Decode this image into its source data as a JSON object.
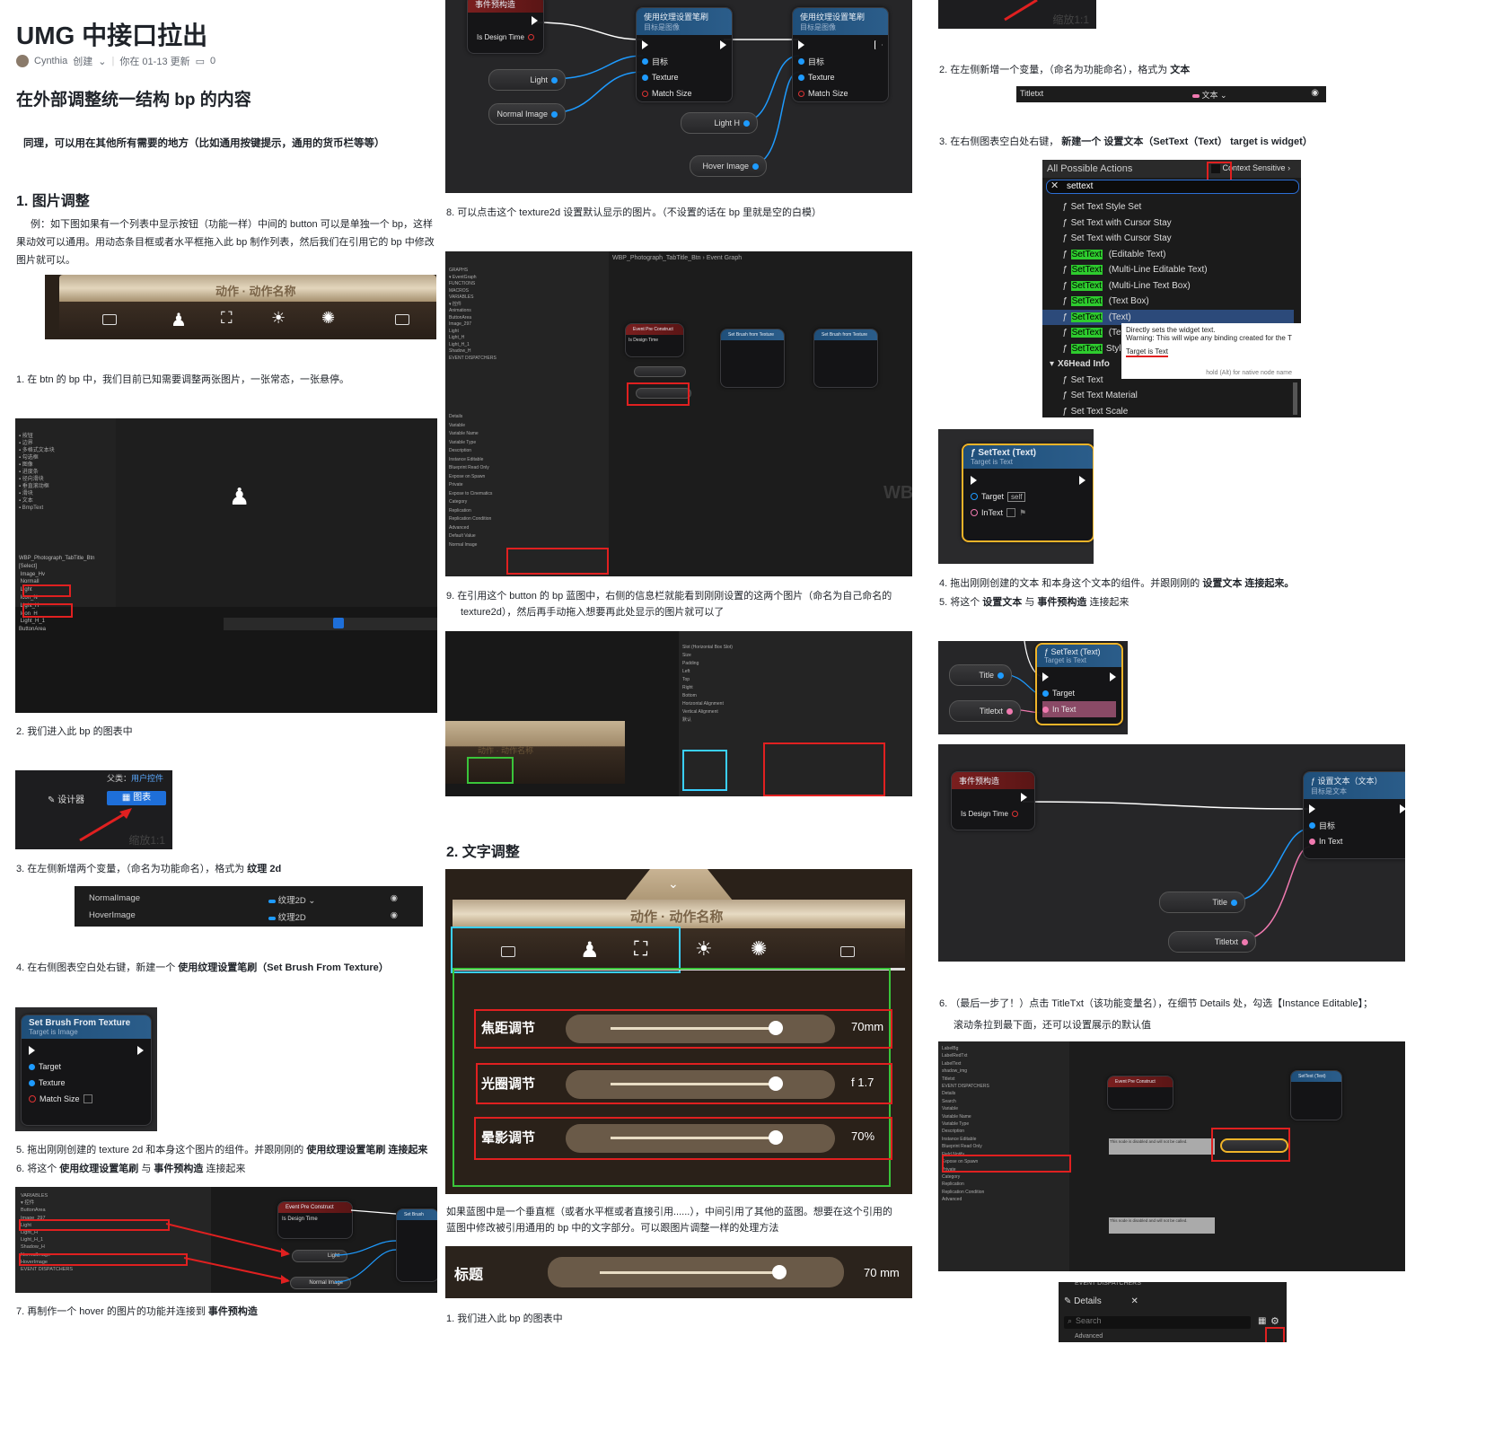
{
  "article": {
    "title": "UMG 中接口拉出",
    "author": "Cynthia",
    "author_action": "创建",
    "updated": "你在 01-13 更新",
    "comment_count": "0",
    "subtitle": "在外部调整统一结构 bp 的内容",
    "intro": "同理，可以用在其他所有需要的地方（比如通用按键提示，通用的货币栏等等）"
  },
  "section1": {
    "heading": "1.  图片调整",
    "para_line1": "例：如下图如果有一个列表中显示按钮（功能一样）中间的 button 可以是单独一个 bp，这样",
    "para_line2": "果动效可以通用。用动态条目框或者水平框拖入此 bp 制作列表，然后我们在引用它的 bp 中修改",
    "para_line3": "图片就可以。",
    "step1": "1.  在 btn 的 bp 中，我们目前已知需要调整两张图片，一张常态，一张悬停。",
    "step2": "2.  我们进入此 bp 的图表中",
    "step3_prefix": "3.  在左侧新增两个变量，（命名为功能命名），格式为",
    "step3_bold": "纹理 2d",
    "step4_prefix": "4.  在右侧图表空白处右键，新建一个",
    "step4_bold": "使用纹理设置笔刷（Set Brush From Texture）",
    "step5_prefix": "5.  拖出刚刚创建的 texture 2d 和本身这个图片的组件。并跟刚刚的",
    "step5_bold": "使用纹理设置笔刷 连接起来",
    "step6_prefix": "6.  将这个",
    "step6_bold1": "使用纹理设置笔刷",
    "step6_mid": "与",
    "step6_bold2": "事件预构造",
    "step6_suffix": "连接起来",
    "step7_prefix": "7.  再制作一个 hover 的图片的功能并连接到",
    "step7_bold": "事件预构造",
    "step8": "8.  可以点击这个 texture2d 设置默认显示的图片。（不设置的话在 bp 里就是空的白模）",
    "step9_line1": "9.  在引用这个 button 的 bp 蓝图中，右侧的信息栏就能看到刚刚设置的这两个图片（命名为自己命名的",
    "step9_line2": "texture2d），然后再手动拖入想要再此处显示的图片就可以了"
  },
  "section2": {
    "heading": "2.  文字调整",
    "para_line1": "如果蓝图中是一个垂直框（或者水平框或者直接引用......），中间引用了其他的蓝图。想要在这个引用的",
    "para_line2": "蓝图中修改被引用通用的 bp 中的文字部分。可以跟图片调整一样的处理方法",
    "step1": "1.  我们进入此 bp 的图表中",
    "step2_prefix": "2.  在左侧新增一个变量，（命名为功能命名），格式为",
    "step2_bold": "文本",
    "step3_prefix": "3.  在右侧图表空白处右键，",
    "step3_bold": "新建一个 设置文本（SetText（Text） target is widget）",
    "step4_prefix": "4.  拖出刚刚创建的文本 和本身这个文本的组件。并跟刚刚的",
    "step4_bold": "设置文本 连接起来。",
    "step5_prefix": "5.  将这个",
    "step5_bold1": "设置文本",
    "step5_mid": "与",
    "step5_bold2": "事件预构造",
    "step5_suffix": "连接起来",
    "step6_line1": "6.  （最后一步了！）点击 TitleTxt（该功能变量名），在细节 Details 处，勾选【Instance Editable】；",
    "step6_line2": "滚动条拉到最下面，还可以设置展示的默认值"
  },
  "ui": {
    "game_title": "动作 · 动作名称",
    "designer_tab": "设计器",
    "graph_tab": "图表",
    "parent_label": "父类：",
    "parent_value": "用户控件",
    "zoom_label": "缩放1:1",
    "var_normal": "NormalImage",
    "var_hover": "HoverImage",
    "var_type": "纹理2D",
    "var_titletxt": "Titletxt",
    "var_text_type": "文本",
    "node_set_brush": "Set Brush From Texture",
    "node_target_image": "Target is Image",
    "pin_target": "Target",
    "pin_texture": "Texture",
    "pin_match_size": "Match Size",
    "node_use_texture": "使用纹理设置笔刷",
    "node_target_image_cn": "目标是图像",
    "pin_target_cn": "目标",
    "event_preconstruct": "事件预构造",
    "is_design_time": "Is Design Time",
    "var_light": "Light",
    "var_light_h": "Light H",
    "var_normal_image": "Normal Image",
    "var_hover_image": "Hover Image",
    "all_actions": "All Possible Actions",
    "context_sensitive": "Context Sensitive",
    "search_value": "settext",
    "actions": [
      "Set Text Style Set",
      "Set Text with Cursor Stay",
      "Set Text with Cursor Stay",
      "SetText (Editable Text)",
      "SetText (Multi-Line Editable Text)",
      "SetText (Multi-Line Text Box)",
      "SetText (Text Box)",
      "SetText (Text)",
      "SetText (Text)",
      "SetTextStyle"
    ],
    "category_x6": "X6Head Info",
    "actions2": [
      "Set Text",
      "Set Text Material",
      "Set Text Scale"
    ],
    "tooltip_line1": "Directly sets the widget text.",
    "tooltip_line2": "Warning: This will wipe any binding created for the T",
    "tooltip_target": "Target is Text",
    "tooltip_hold": "hold (Alt) for native node name",
    "node_settext": "SetText (Text)",
    "node_target_text": "Target is Text",
    "pin_self": "self",
    "pin_intext": "InText",
    "pin_in_text": "In Text",
    "var_title": "Title",
    "var_titletxt2": "Titletxt",
    "node_settext_cn": "设置文本（文本）",
    "node_target_text_cn": "目标是文本",
    "pin_intext_cn": "In Text",
    "slider1": "焦距调节",
    "slider1_val": "70mm",
    "slider2": "光圈调节",
    "slider2_val": "f 1.7",
    "slider3": "晕影调节",
    "slider3_val": "70%",
    "caption_label": "标题",
    "caption_val": "70 mm",
    "details": "Details",
    "search": "Search",
    "event_dispatchers": "EVENT DISPATCHERS",
    "advanced": "Advanced",
    "wbp_path": "WBP_Photograph_TabTitle_Btn",
    "event_graph": "Event Graph",
    "event_pre_construct_en": "Event Pre Construct",
    "instance_editable": "Instance Editable"
  },
  "colors": {
    "red_box": "#e02020",
    "green_box": "#3ac43a",
    "pin_blue": "#1e9bff",
    "pin_pink": "#f07ab0",
    "node_header_blue": "#1f4f7a",
    "event_red": "#7a1f1f",
    "settext_border": "#f0b429"
  }
}
